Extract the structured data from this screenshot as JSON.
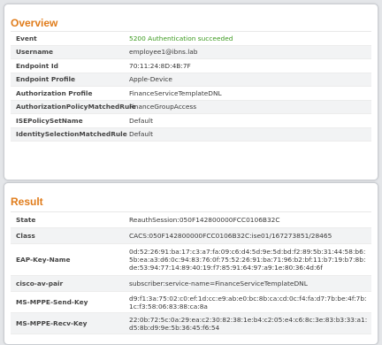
{
  "overview": {
    "title": "Overview",
    "rows": [
      {
        "label": "Event",
        "value": "5200 Authentication succeeded"
      },
      {
        "label": "Username",
        "value": "employee1@ibns.lab"
      },
      {
        "label": "Endpoint Id",
        "value": "70:11:24:8D:4B:7F"
      },
      {
        "label": "Endpoint Profile",
        "value": "Apple-Device"
      },
      {
        "label": "Authorization Profile",
        "value": "FinanceServiceTemplateDNL"
      },
      {
        "label": "AuthorizationPolicyMatchedRule",
        "value": "FinanceGroupAccess"
      },
      {
        "label": "ISEPolicySetName",
        "value": "Default"
      },
      {
        "label": "IdentitySelectionMatchedRule",
        "value": "Default"
      }
    ],
    "status_color": "#3c9a1f"
  },
  "result": {
    "title": "Result",
    "rows": [
      {
        "label": "State",
        "value": "ReauthSession:050F142800000FCC0106B32C"
      },
      {
        "label": "Class",
        "value": "CACS:050F142800000FCC0106B32C:ise01/167273851/28465"
      },
      {
        "label": "EAP-Key-Name",
        "value": "0d:52:26:91:ba:17:c3:a7:fa:09:c6:d4:5d:9e:5d:bd:f2:89:5b:31:44:58:b6:5b:ea:a3:d6:0c:94:83:76:0f:75:52:26:91:ba:71:96:b2:bf:11:b7:19:b7:8b:de:53:94:77:14:89:40:19:f7:85:91:64:97:a9:1e:80:36:4d:6f"
      },
      {
        "label": "cisco-av-pair",
        "value": "subscriber:service-name=FinanceServiceTemplateDNL"
      },
      {
        "label": "MS-MPPE-Send-Key",
        "value": "d9:f1:3a:75:02:c0:ef:1d:cc:e9:ab:e0:bc:8b:ca:cd:0c:f4:fa:d7:7b:be:4f:7b:1c:f3:58:06:83:88:ca:8a"
      },
      {
        "label": "MS-MPPE-Recv-Key",
        "value": "22:0b:72:5c:0a:29:ea:c2:30:82:38:1e:b4:c2:05:e4:c6:8c:3e:83:b3:33:a1:d5:8b:d9:9e:5b:36:45:f6:54"
      }
    ]
  }
}
